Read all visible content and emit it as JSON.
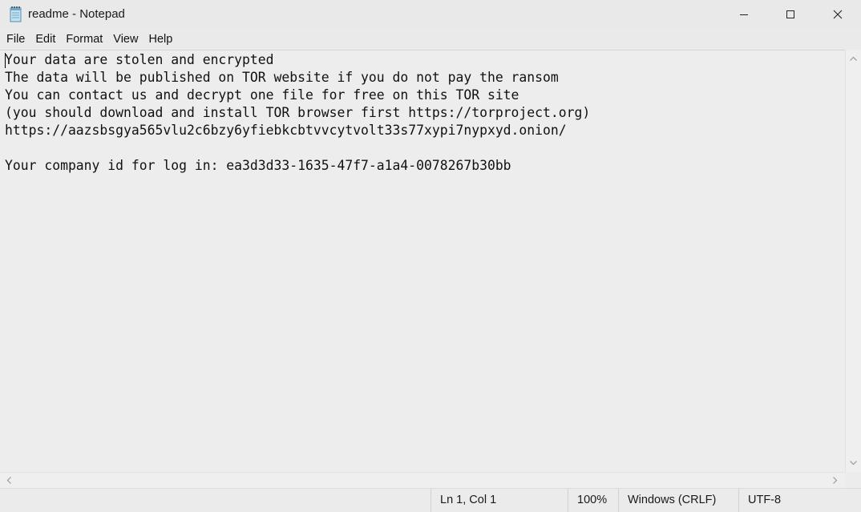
{
  "window": {
    "title": "readme - Notepad",
    "app_icon": "notepad-icon"
  },
  "controls": {
    "minimize_icon": "minimize-icon",
    "maximize_icon": "maximize-icon",
    "close_icon": "close-icon"
  },
  "menu": {
    "items": [
      "File",
      "Edit",
      "Format",
      "View",
      "Help"
    ]
  },
  "editor": {
    "lines": [
      "Your data are stolen and encrypted",
      "The data will be published on TOR website if you do not pay the ransom",
      "You can contact us and decrypt one file for free on this TOR site",
      "(you should download and install TOR browser first https://torproject.org)",
      "https://aazsbsgya565vlu2c6bzy6yfiebkcbtvvcytvolt33s77xypi7nypxyd.onion/",
      "",
      "Your company id for log in: ea3d3d33-1635-47f7-a1a4-0078267b30bb"
    ]
  },
  "status": {
    "position": "Ln 1, Col 1",
    "zoom": "100%",
    "line_ending": "Windows (CRLF)",
    "encoding": "UTF-8"
  }
}
